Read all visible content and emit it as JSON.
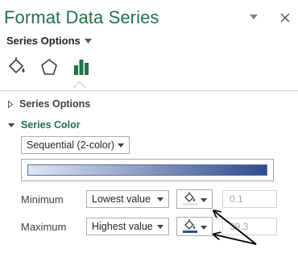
{
  "pane": {
    "title": "Format Data Series",
    "title_dropdown_icon": "chevron-down-icon",
    "close_icon": "close-icon"
  },
  "series_options_menu": {
    "label": "Series Options",
    "icon": "chevron-down-icon"
  },
  "tabs": [
    {
      "name": "Fill & Line",
      "icon": "paint-bucket-icon"
    },
    {
      "name": "Effects",
      "icon": "pentagon-icon"
    },
    {
      "name": "Series Options",
      "icon": "bar-chart-icon",
      "active": true
    }
  ],
  "sections": {
    "series_options": {
      "label": "Series Options",
      "expanded": false
    },
    "series_color": {
      "label": "Series Color",
      "expanded": true
    }
  },
  "series_color": {
    "scheme": "Sequential (2-color)",
    "gradient": {
      "start_color": "#dfe6f3",
      "end_color": "#2f4b8f"
    },
    "minimum": {
      "label": "Minimum",
      "type": "Lowest value",
      "value": "0.1",
      "color": "#dfe6f3"
    },
    "maximum": {
      "label": "Maximum",
      "type": "Highest value",
      "value": "39.3",
      "color": "#2f4b8f"
    }
  },
  "colors": {
    "accent": "#217346",
    "text": "#262626",
    "border": "#ababab"
  }
}
